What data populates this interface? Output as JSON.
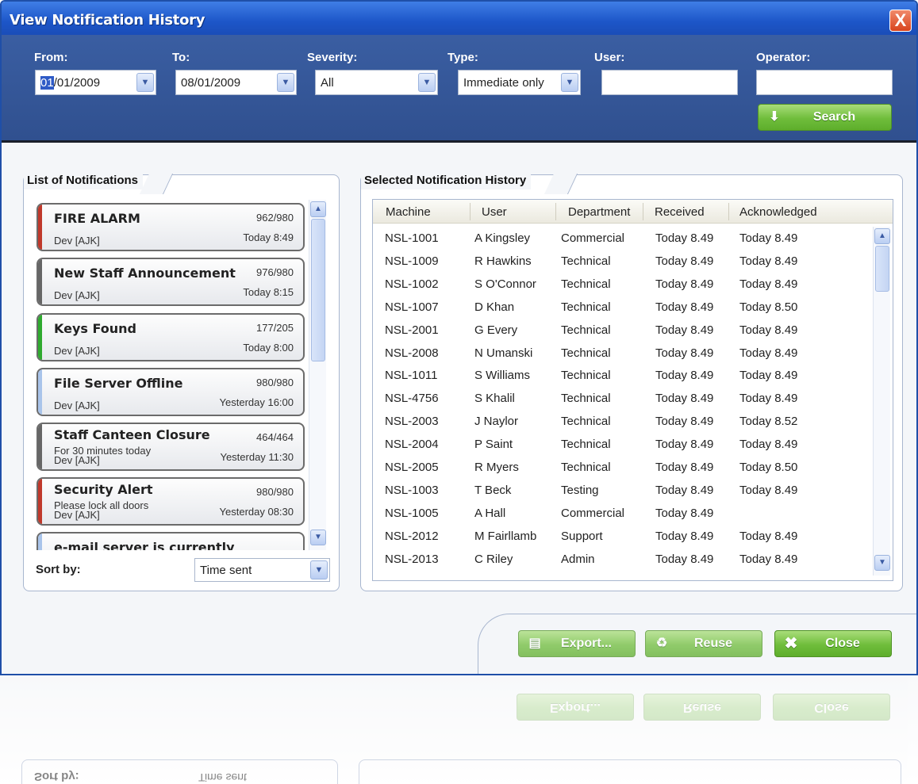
{
  "window": {
    "title": "View Notification History",
    "close_glyph": "X"
  },
  "filters": {
    "from": {
      "label": "From:",
      "value_sel": "01",
      "value_rest": "/01/2009"
    },
    "to": {
      "label": "To:",
      "value": "08/01/2009"
    },
    "severity": {
      "label": "Severity:",
      "value": "All"
    },
    "type": {
      "label": "Type:",
      "value": "Immediate only"
    },
    "user": {
      "label": "User:",
      "value": ""
    },
    "operator": {
      "label": "Operator:",
      "value": ""
    },
    "search_label": "Search"
  },
  "notifications": {
    "title": "List of Notifications",
    "items": [
      {
        "title": "FIRE ALARM",
        "count": "962/980",
        "subtitle": "",
        "author": "Dev [AJK]",
        "time": "Today 8:49",
        "color": "#c0392b"
      },
      {
        "title": "New Staff Announcement",
        "count": "976/980",
        "subtitle": "",
        "author": "Dev [AJK]",
        "time": "Today 8:15",
        "color": "#666666"
      },
      {
        "title": "Keys Found",
        "count": "177/205",
        "subtitle": "",
        "author": "Dev [AJK]",
        "time": "Today 8:00",
        "color": "#2faa2f"
      },
      {
        "title": "File Server Offline",
        "count": "980/980",
        "subtitle": "",
        "author": "Dev [AJK]",
        "time": "Yesterday 16:00",
        "color": "#a9c4ea"
      },
      {
        "title": "Staff Canteen Closure",
        "count": "464/464",
        "subtitle": "For 30 minutes today",
        "author": "Dev [AJK]",
        "time": "Yesterday 11:30",
        "color": "#666666"
      },
      {
        "title": "Security Alert",
        "count": "980/980",
        "subtitle": "Please lock all doors",
        "author": "Dev [AJK]",
        "time": "Yesterday 08:30",
        "color": "#c0392b"
      },
      {
        "title": "e-mail server is currently",
        "count": "",
        "subtitle": "",
        "author": "",
        "time": "",
        "color": "#a9c4ea"
      }
    ],
    "sort_label": "Sort by:",
    "sort_value": "Time sent"
  },
  "history": {
    "title": "Selected Notification History",
    "columns": [
      "Machine",
      "User",
      "Department",
      "Received",
      "Acknowledged"
    ],
    "rows": [
      [
        "NSL-1001",
        "A Kingsley",
        "Commercial",
        "Today 8.49",
        "Today 8.49"
      ],
      [
        "NSL-1009",
        "R Hawkins",
        "Technical",
        "Today 8.49",
        "Today 8.49"
      ],
      [
        "NSL-1002",
        "S O'Connor",
        "Technical",
        "Today 8.49",
        "Today 8.49"
      ],
      [
        "NSL-1007",
        "D Khan",
        "Technical",
        "Today 8.49",
        "Today 8.50"
      ],
      [
        "NSL-2001",
        "G Every",
        "Technical",
        "Today 8.49",
        "Today 8.49"
      ],
      [
        "NSL-2008",
        "N Umanski",
        "Technical",
        "Today 8.49",
        "Today 8.49"
      ],
      [
        "NSL-1011",
        "S Williams",
        "Technical",
        "Today 8.49",
        "Today 8.49"
      ],
      [
        "NSL-4756",
        "S Khalil",
        "Technical",
        "Today 8.49",
        "Today 8.49"
      ],
      [
        "NSL-2003",
        "J Naylor",
        "Technical",
        "Today 8.49",
        "Today 8.52"
      ],
      [
        "NSL-2004",
        "P Saint",
        "Technical",
        "Today 8.49",
        "Today 8.49"
      ],
      [
        "NSL-2005",
        "R Myers",
        "Technical",
        "Today 8.49",
        "Today 8.50"
      ],
      [
        "NSL-1003",
        "T Beck",
        "Testing",
        "Today 8.49",
        "Today 8.49"
      ],
      [
        "NSL-1005",
        "A Hall",
        "Commercial",
        "Today 8.49",
        ""
      ],
      [
        "NSL-2012",
        "M Fairllamb",
        "Support",
        "Today 8.49",
        "Today 8.49"
      ],
      [
        "NSL-2013",
        "C Riley",
        "Admin",
        "Today 8.49",
        "Today 8.49"
      ]
    ]
  },
  "actions": {
    "export": "Export...",
    "reuse": "Reuse",
    "close": "Close"
  }
}
